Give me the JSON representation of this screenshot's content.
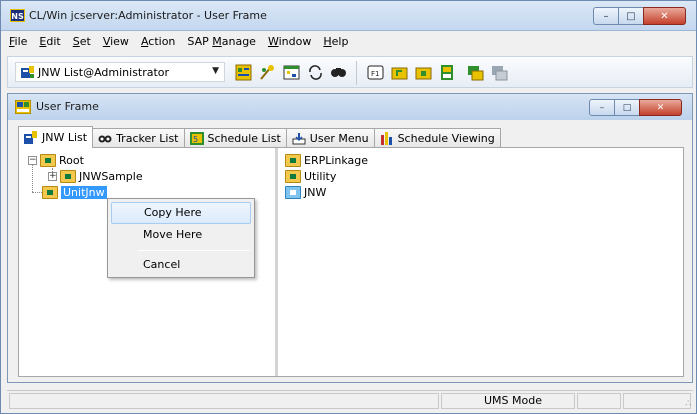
{
  "window": {
    "title": "CL/Win jcserver:Administrator - User Frame",
    "app_icon_text": "NS",
    "minimize_symbol": "–",
    "maximize_symbol": "□",
    "close_symbol": "✕"
  },
  "menubar": {
    "items": [
      {
        "key": "F",
        "rest": "ile"
      },
      {
        "key": "E",
        "rest": "dit"
      },
      {
        "key": "S",
        "rest": "et"
      },
      {
        "key": "V",
        "rest": "iew"
      },
      {
        "key": "A",
        "rest": "ction"
      },
      {
        "key": "",
        "rest": "SAP ",
        "key2": "M",
        "rest2": "anage"
      },
      {
        "key": "W",
        "rest": "indow"
      },
      {
        "key": "H",
        "rest": "elp"
      }
    ]
  },
  "toolbar": {
    "combo_value": "JNW List@Administrator",
    "combo_arrow": "▼",
    "icons": [
      "list-icon",
      "wizard-icon",
      "schedule-icon",
      "refresh-icon",
      "find-icon",
      "f1-icon",
      "folder-up-icon",
      "folder-new-icon",
      "unit-icon",
      "export-icon",
      "import-icon"
    ],
    "colors": {
      "accent_green": "#2f8f2f",
      "accent_yellow": "#e8c200",
      "accent_blue": "#1c4fa8"
    }
  },
  "frame": {
    "title": "User Frame"
  },
  "tabs": [
    {
      "label": "JNW List",
      "icon": "jnw-list-icon",
      "active": true
    },
    {
      "label": "Tracker List",
      "icon": "tracker-binoculars-icon",
      "active": false
    },
    {
      "label": "Schedule List",
      "icon": "schedule-list-icon",
      "active": false
    },
    {
      "label": "User Menu",
      "icon": "user-menu-icon",
      "active": false
    },
    {
      "label": "Schedule Viewing",
      "icon": "schedule-viewing-icon",
      "active": false
    }
  ],
  "tree": {
    "root": "Root",
    "child": "JNWSample",
    "selected": "UnitJnw",
    "collapse_symbol": "−",
    "expand_symbol": "+"
  },
  "list": {
    "items": [
      "ERPLinkage",
      "Utility",
      "JNW"
    ]
  },
  "context_menu": {
    "items": [
      "Copy Here",
      "Move Here",
      "Cancel"
    ]
  },
  "statusbar": {
    "mode": "UMS Mode",
    "grip": "∴"
  }
}
